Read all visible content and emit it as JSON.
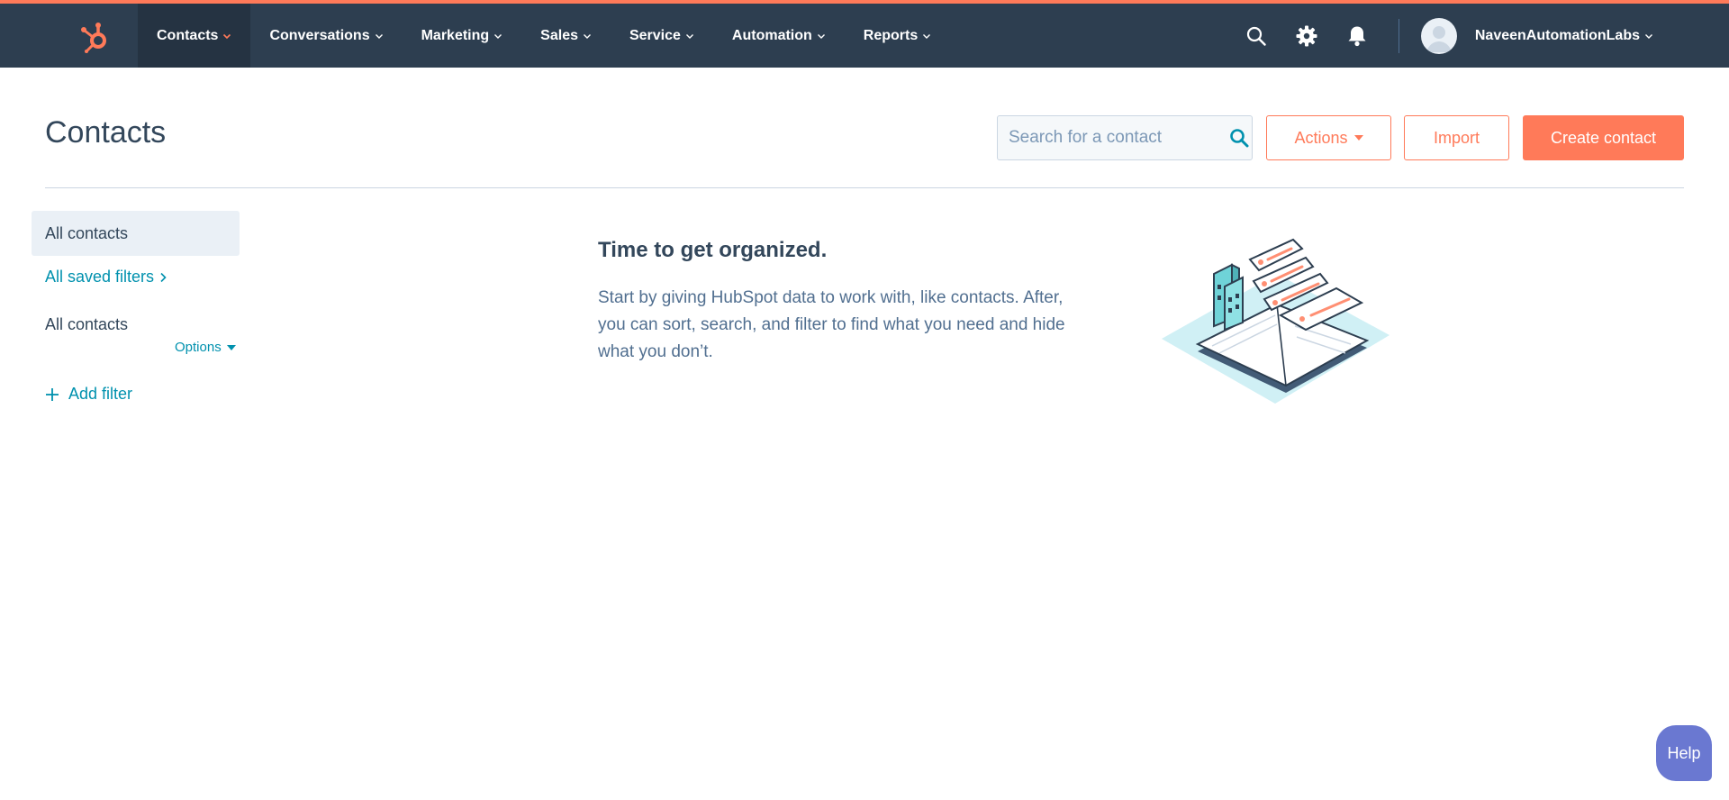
{
  "nav": {
    "items": [
      {
        "label": "Contacts",
        "active": true
      },
      {
        "label": "Conversations",
        "active": false
      },
      {
        "label": "Marketing",
        "active": false
      },
      {
        "label": "Sales",
        "active": false
      },
      {
        "label": "Service",
        "active": false
      },
      {
        "label": "Automation",
        "active": false
      },
      {
        "label": "Reports",
        "active": false
      }
    ],
    "icons": [
      "hubspot-logo-icon",
      "search-icon",
      "gear-icon",
      "bell-icon",
      "chevron-down-icon"
    ],
    "account_name": "NaveenAutomationLabs"
  },
  "header": {
    "title": "Contacts",
    "search_placeholder": "Search for a contact",
    "actions_label": "Actions",
    "import_label": "Import",
    "create_label": "Create contact"
  },
  "sidebar": {
    "active_view": "All contacts",
    "saved_filters_label": "All saved filters",
    "current_view": "All contacts",
    "options_label": "Options",
    "add_filter_label": "Add filter"
  },
  "empty_state": {
    "heading": "Time to get organized.",
    "body": "Start by giving HubSpot data to work with, like contacts. After, you can sort, search, and filter to find what you need and hide what you don’t."
  },
  "help": {
    "label": "Help"
  },
  "colors": {
    "nav_bg": "#2d3e50",
    "accent": "#ff7a59",
    "link": "#0091ae",
    "text": "#33475b",
    "help": "#6a78d1"
  }
}
